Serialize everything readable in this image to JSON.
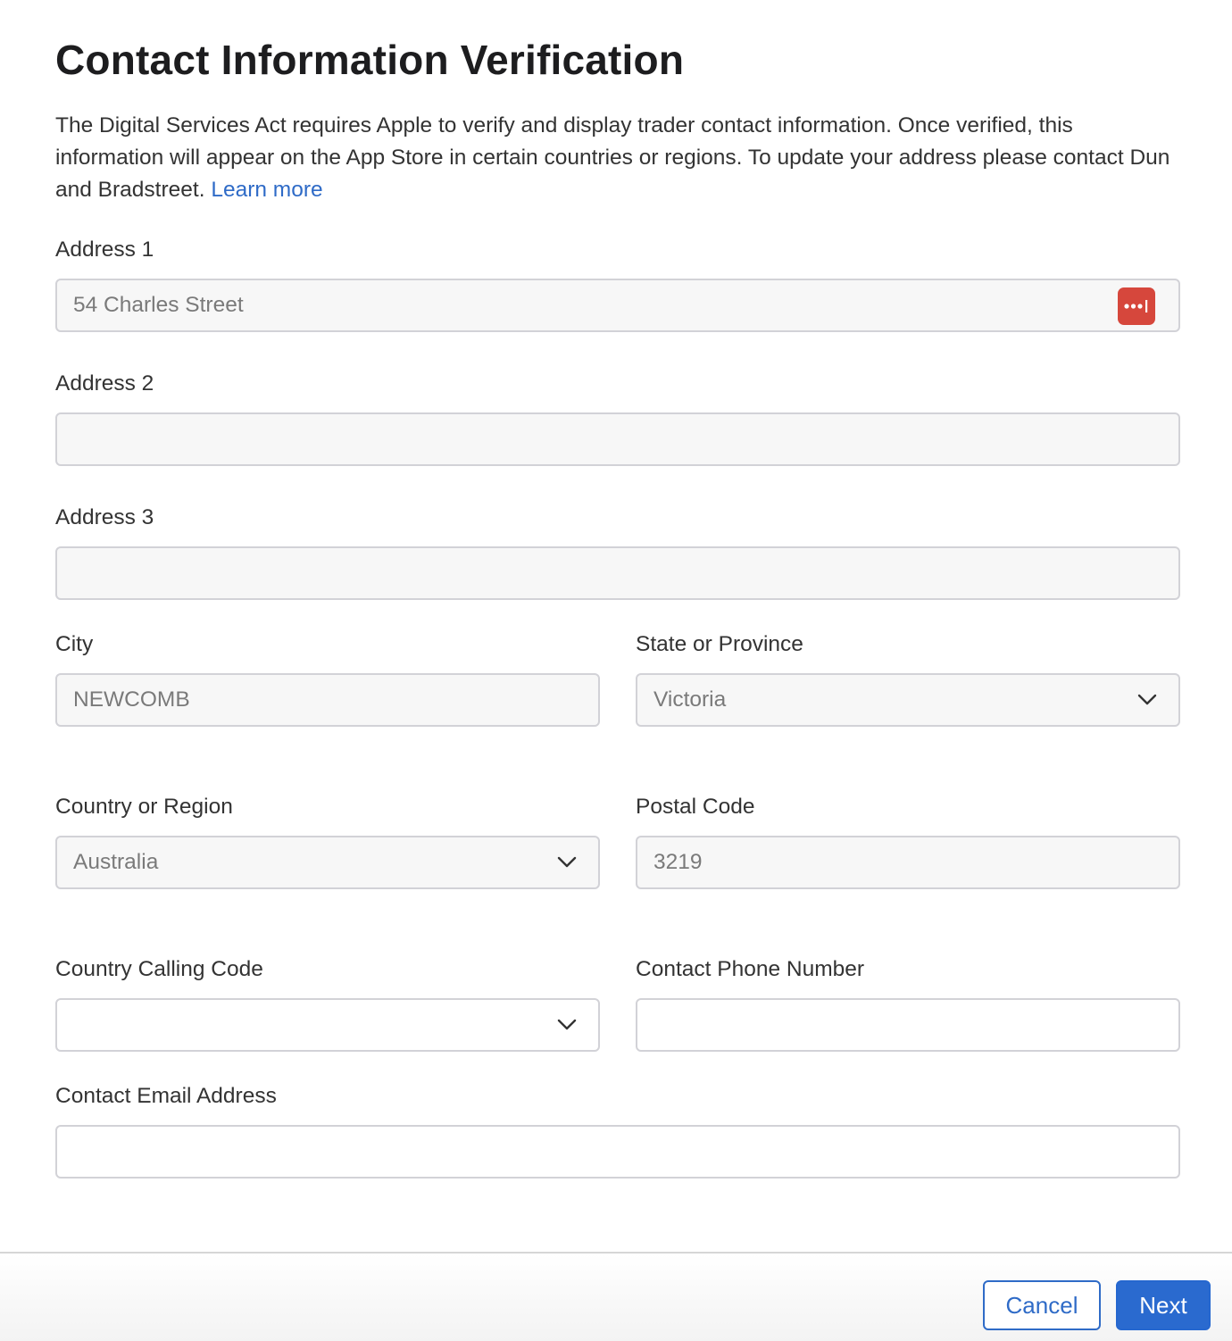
{
  "page": {
    "title": "Contact Information Verification",
    "intro_text": "The Digital Services Act requires Apple to verify and display trader contact information. Once verified, this information will appear on the App Store in certain countries or regions. To update your address please contact Dun and Bradstreet.",
    "learn_more_link": "Learn more"
  },
  "form": {
    "address1": {
      "label": "Address 1",
      "value": "54 Charles Street"
    },
    "address2": {
      "label": "Address 2",
      "value": ""
    },
    "address3": {
      "label": "Address 3",
      "value": ""
    },
    "city": {
      "label": "City",
      "value": "NEWCOMB"
    },
    "state": {
      "label": "State or Province",
      "value": "Victoria"
    },
    "country": {
      "label": "Country or Region",
      "value": "Australia"
    },
    "postal_code": {
      "label": "Postal Code",
      "value": "3219"
    },
    "calling_code": {
      "label": "Country Calling Code",
      "value": ""
    },
    "phone": {
      "label": "Contact Phone Number",
      "value": ""
    },
    "email": {
      "label": "Contact Email Address",
      "value": ""
    }
  },
  "footer": {
    "cancel_label": "Cancel",
    "next_label": "Next"
  },
  "icons": {
    "password_manager": "password-manager-icon",
    "dropdown": "chevron-down-icon"
  },
  "colors": {
    "link": "#2f6bc7",
    "primary_button": "#2a6acf",
    "password_icon": "#d6473c"
  }
}
